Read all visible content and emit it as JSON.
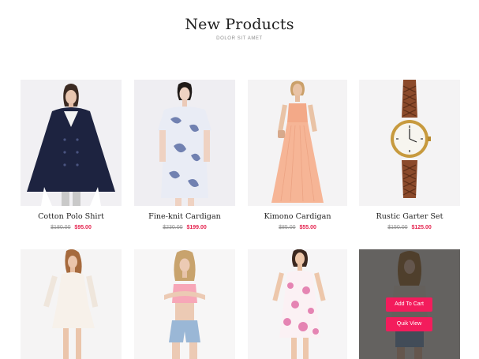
{
  "section": {
    "title": "New Products",
    "subtitle": "DOLOR SIT AMET"
  },
  "products": [
    {
      "name": "Cotton Polo Shirt",
      "old_price": "$180.00",
      "price": "$95.00"
    },
    {
      "name": "Fine-knit Cardigan",
      "old_price": "$230.00",
      "price": "$199.00"
    },
    {
      "name": "Kimono Cardigan",
      "old_price": "$85.00",
      "price": "$55.00"
    },
    {
      "name": "Rustic Garter Set",
      "old_price": "$150.00",
      "price": "$125.00"
    },
    {
      "name": "",
      "old_price": "",
      "price": ""
    },
    {
      "name": "",
      "old_price": "",
      "price": ""
    },
    {
      "name": "",
      "old_price": "",
      "price": ""
    },
    {
      "name": "",
      "old_price": "",
      "price": ""
    }
  ],
  "hover_actions": {
    "add_to_cart": "Add To Cart",
    "quick_view": "Quik View"
  },
  "colors": {
    "accent": "#f31c5c",
    "price_sale": "#e5234f",
    "price_old": "#8e8e8e"
  }
}
